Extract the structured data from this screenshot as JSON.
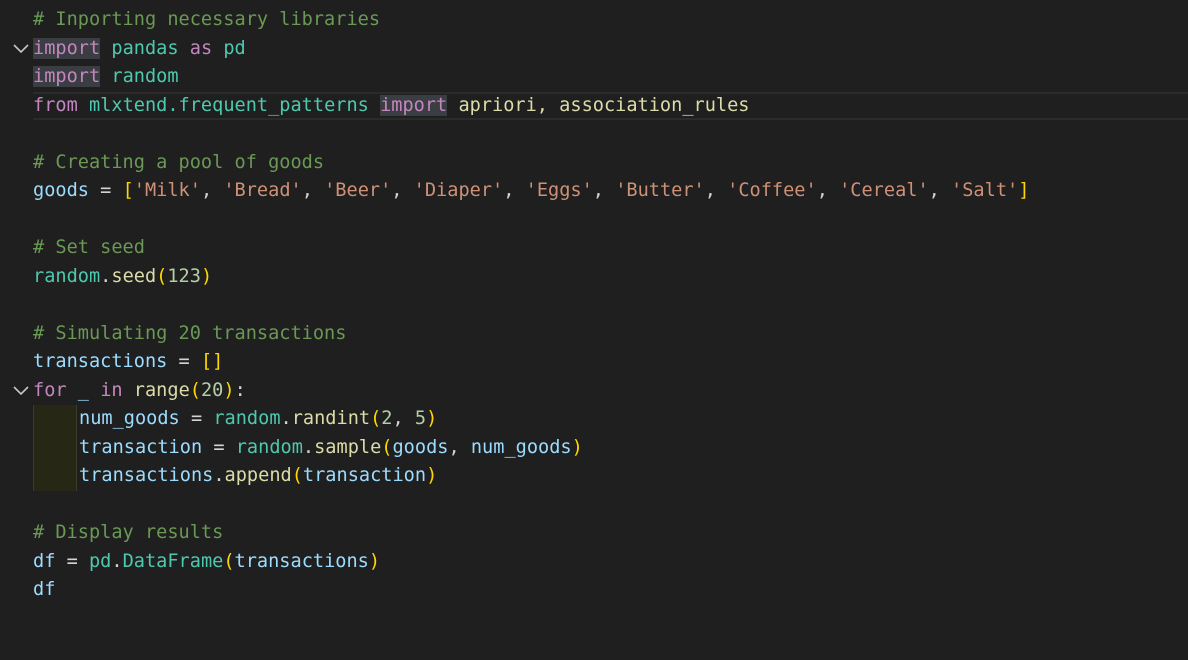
{
  "editor": {
    "colors": {
      "background": "#1f1f1f",
      "comment": "#6a9955",
      "keyword": "#c586c0",
      "module": "#4ec9b0",
      "variable": "#9cdcfe",
      "function": "#dcdcaa",
      "string": "#ce9178",
      "number": "#b5cea8",
      "bracket": "#ffd700"
    },
    "fold_icons": [
      "chevron-down-icon",
      "chevron-down-icon"
    ],
    "lines": {
      "l1": {
        "comment": "# Inporting necessary libraries"
      },
      "l2": {
        "kw_import": "import",
        "module": "pandas",
        "kw_as": "as",
        "alias": "pd"
      },
      "l3": {
        "kw_import": "import",
        "module": "random"
      },
      "l4": {
        "kw_from": "from",
        "module": "mlxtend.frequent_patterns",
        "kw_import": "import",
        "names": "apriori, association_rules"
      },
      "l6": {
        "comment": "# Creating a pool of goods"
      },
      "l7": {
        "var": "goods",
        "eq": " = ",
        "open": "[",
        "items": [
          "'Milk'",
          "'Bread'",
          "'Beer'",
          "'Diaper'",
          "'Eggs'",
          "'Butter'",
          "'Coffee'",
          "'Cereal'",
          "'Salt'"
        ],
        "sep": ", ",
        "close": "]"
      },
      "l9": {
        "comment": "# Set seed"
      },
      "l10": {
        "module": "random",
        "dot": ".",
        "fn": "seed",
        "open": "(",
        "num": "123",
        "close": ")"
      },
      "l12": {
        "comment": "# Simulating 20 transactions"
      },
      "l13": {
        "var": "transactions",
        "eq": " = ",
        "list": "[]"
      },
      "l14": {
        "kw_for": "for",
        "underscore": "_",
        "kw_in": "in",
        "fn": "range",
        "open": "(",
        "num": "20",
        "close": ")",
        "colon": ":"
      },
      "l15": {
        "var": "num_goods",
        "eq": " = ",
        "module": "random",
        "dot": ".",
        "fn": "randint",
        "open": "(",
        "n1": "2",
        "sep": ", ",
        "n2": "5",
        "close": ")"
      },
      "l16": {
        "var": "transaction",
        "eq": " = ",
        "module": "random",
        "dot": ".",
        "fn": "sample",
        "open": "(",
        "a1": "goods",
        "sep": ", ",
        "a2": "num_goods",
        "close": ")"
      },
      "l17": {
        "var": "transactions",
        "dot": ".",
        "fn": "append",
        "open": "(",
        "a1": "transaction",
        "close": ")"
      },
      "l19": {
        "comment": "# Display results"
      },
      "l20": {
        "var": "df",
        "eq": " = ",
        "module": "pd",
        "dot": ".",
        "fn": "DataFrame",
        "open": "(",
        "a1": "transactions",
        "close": ")"
      },
      "l21": {
        "var": "df"
      }
    }
  }
}
